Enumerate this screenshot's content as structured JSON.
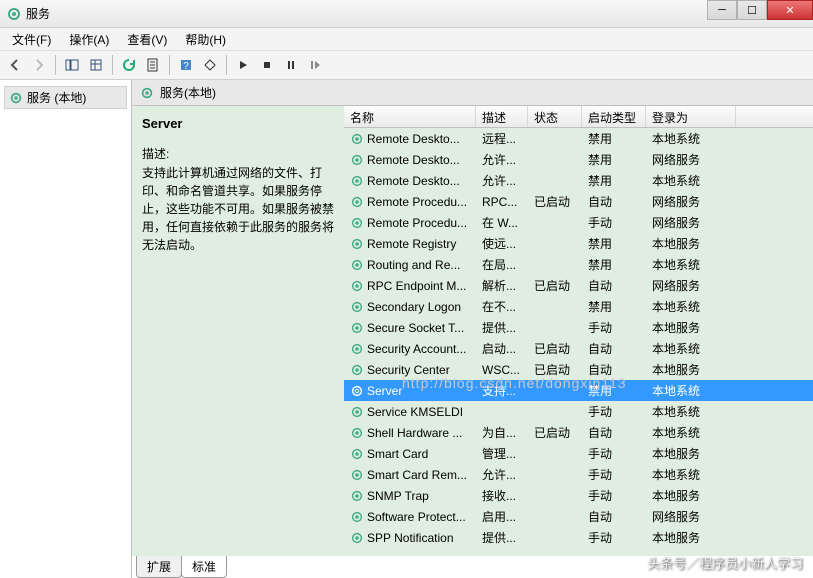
{
  "window": {
    "title": "服务"
  },
  "menu": {
    "file": "文件(F)",
    "action": "操作(A)",
    "view": "查看(V)",
    "help": "帮助(H)"
  },
  "leftTree": {
    "rootLabel": "服务 (本地)"
  },
  "paneHeader": "服务(本地)",
  "detail": {
    "title": "Server",
    "descLabel": "描述:",
    "desc": "支持此计算机通过网络的文件、打印、和命名管道共享。如果服务停止，这些功能不可用。如果服务被禁用，任何直接依赖于此服务的服务将无法启动。"
  },
  "columns": {
    "name": "名称",
    "desc": "描述",
    "status": "状态",
    "startup": "启动类型",
    "logon": "登录为"
  },
  "services": [
    {
      "name": "Remote Deskto...",
      "desc": "远程...",
      "status": "",
      "startup": "禁用",
      "logon": "本地系统",
      "sel": false
    },
    {
      "name": "Remote Deskto...",
      "desc": "允许...",
      "status": "",
      "startup": "禁用",
      "logon": "网络服务",
      "sel": false
    },
    {
      "name": "Remote Deskto...",
      "desc": "允许...",
      "status": "",
      "startup": "禁用",
      "logon": "本地系统",
      "sel": false
    },
    {
      "name": "Remote Procedu...",
      "desc": "RPC...",
      "status": "已启动",
      "startup": "自动",
      "logon": "网络服务",
      "sel": false
    },
    {
      "name": "Remote Procedu...",
      "desc": "在 W...",
      "status": "",
      "startup": "手动",
      "logon": "网络服务",
      "sel": false
    },
    {
      "name": "Remote Registry",
      "desc": "使远...",
      "status": "",
      "startup": "禁用",
      "logon": "本地服务",
      "sel": false
    },
    {
      "name": "Routing and Re...",
      "desc": "在局...",
      "status": "",
      "startup": "禁用",
      "logon": "本地系统",
      "sel": false
    },
    {
      "name": "RPC Endpoint M...",
      "desc": "解析...",
      "status": "已启动",
      "startup": "自动",
      "logon": "网络服务",
      "sel": false
    },
    {
      "name": "Secondary Logon",
      "desc": "在不...",
      "status": "",
      "startup": "禁用",
      "logon": "本地系统",
      "sel": false
    },
    {
      "name": "Secure Socket T...",
      "desc": "提供...",
      "status": "",
      "startup": "手动",
      "logon": "本地服务",
      "sel": false
    },
    {
      "name": "Security Account...",
      "desc": "启动...",
      "status": "已启动",
      "startup": "自动",
      "logon": "本地系统",
      "sel": false
    },
    {
      "name": "Security Center",
      "desc": "WSC...",
      "status": "已启动",
      "startup": "自动",
      "logon": "本地服务",
      "sel": false
    },
    {
      "name": "Server",
      "desc": "支持...",
      "status": "",
      "startup": "禁用",
      "logon": "本地系统",
      "sel": true
    },
    {
      "name": "Service KMSELDI",
      "desc": "",
      "status": "",
      "startup": "手动",
      "logon": "本地系统",
      "sel": false
    },
    {
      "name": "Shell Hardware ...",
      "desc": "为自...",
      "status": "已启动",
      "startup": "自动",
      "logon": "本地系统",
      "sel": false
    },
    {
      "name": "Smart Card",
      "desc": "管理...",
      "status": "",
      "startup": "手动",
      "logon": "本地服务",
      "sel": false
    },
    {
      "name": "Smart Card Rem...",
      "desc": "允许...",
      "status": "",
      "startup": "手动",
      "logon": "本地系统",
      "sel": false
    },
    {
      "name": "SNMP Trap",
      "desc": "接收...",
      "status": "",
      "startup": "手动",
      "logon": "本地服务",
      "sel": false
    },
    {
      "name": "Software Protect...",
      "desc": "启用...",
      "status": "",
      "startup": "自动",
      "logon": "网络服务",
      "sel": false
    },
    {
      "name": "SPP Notification",
      "desc": "提供...",
      "status": "",
      "startup": "手动",
      "logon": "本地服务",
      "sel": false
    }
  ],
  "tabs": {
    "extended": "扩展",
    "standard": "标准"
  },
  "watermark": "http://blog.csdn.net/dongxin113",
  "footerWatermark": "头条号／程序员小新人学习"
}
